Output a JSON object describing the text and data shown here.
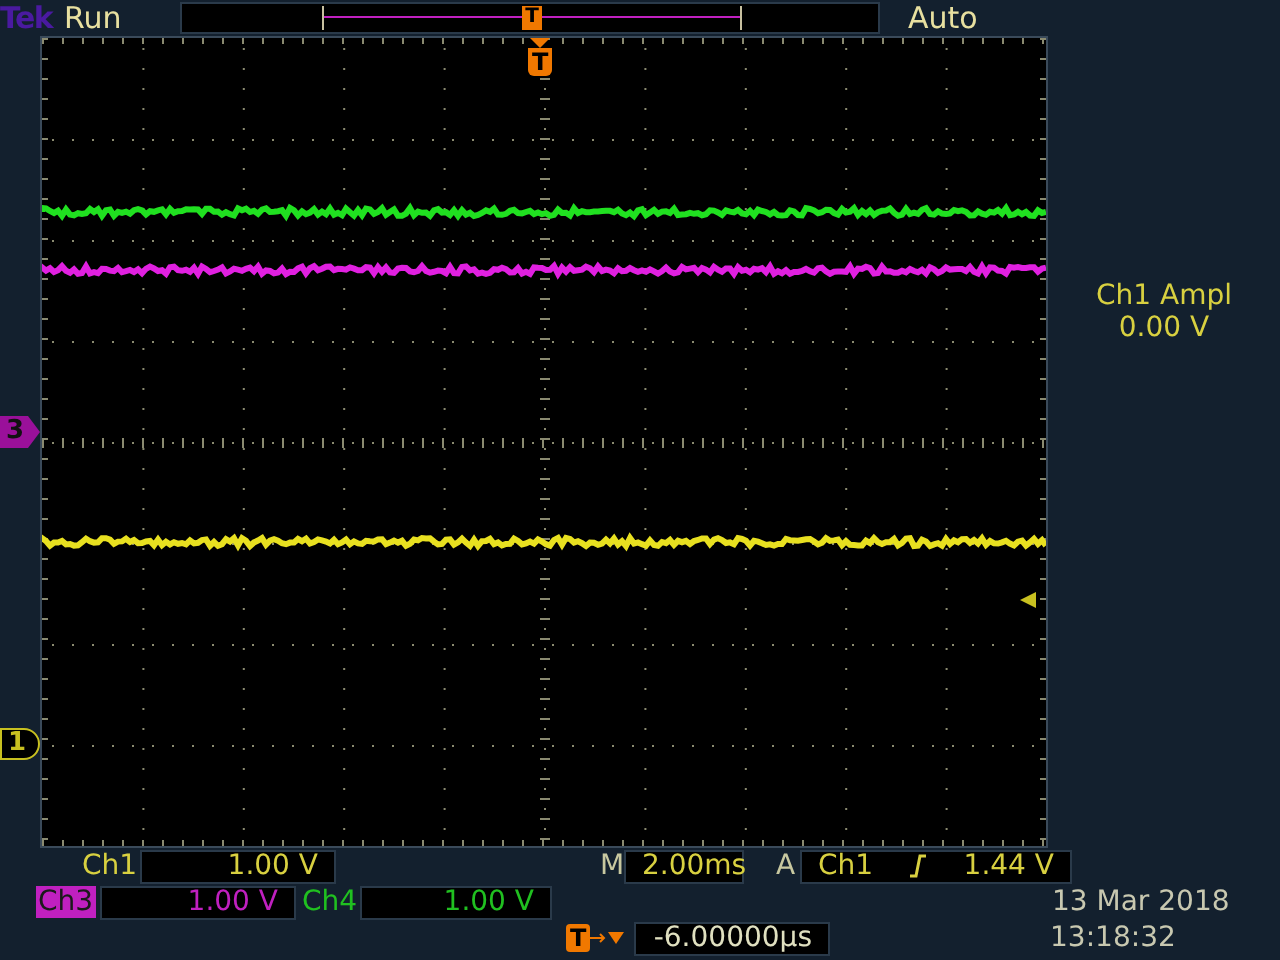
{
  "header": {
    "logo": "Tek",
    "status": "Run",
    "trigger_mode": "Auto",
    "record_marker": "T"
  },
  "display": {
    "trigger_marker": "T",
    "channel_markers": [
      {
        "label": "3",
        "color": "#9a109a"
      },
      {
        "label": "1",
        "color": "#c8c020"
      }
    ],
    "traces": [
      {
        "color": "#20e020"
      },
      {
        "color": "#e020e0"
      },
      {
        "color": "#e8e020"
      }
    ]
  },
  "measurement": {
    "label": "Ch1 Ampl",
    "value": "0.00 V"
  },
  "channels": [
    {
      "label": "Ch1",
      "scale": "1.00 V",
      "color": "#d8d040",
      "selected": false
    },
    {
      "label": "Ch3",
      "scale": "1.00 V",
      "color": "#c020c0",
      "selected": true
    },
    {
      "label": "Ch4",
      "scale": "1.00 V",
      "color": "#20c020",
      "selected": false
    }
  ],
  "timebase": {
    "prefix": "M",
    "value": "2.00ms"
  },
  "trigger": {
    "prefix": "A",
    "source": "Ch1",
    "level": "1.44 V"
  },
  "position": {
    "marker": "T",
    "value": "-6.00000µs"
  },
  "date": "13 Mar 2018",
  "time": "13:18:32"
}
